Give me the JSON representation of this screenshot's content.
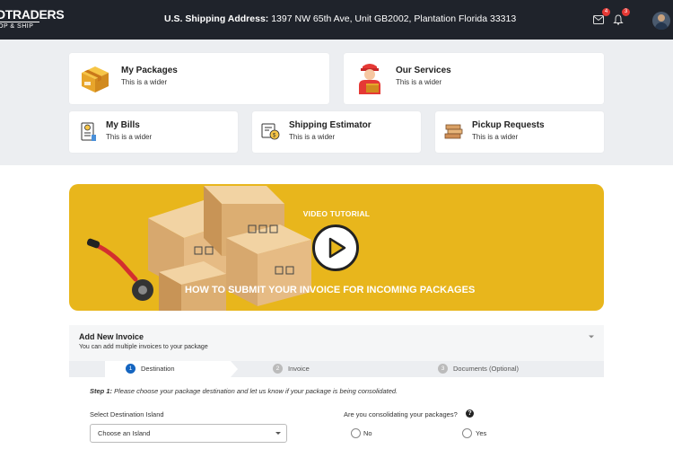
{
  "header": {
    "logo_main": "DTRADERS",
    "logo_sub": "OP & SHIP",
    "address_label": "U.S. Shipping Address:",
    "address_value": " 1397 NW 65th Ave, Unit GB2002, Plantation Florida 33313",
    "mail_badge": "4",
    "bell_badge": "3",
    "icons": [
      "mail-icon",
      "bell-icon"
    ]
  },
  "cards": [
    {
      "title": "My Packages",
      "subtitle": "This is a wider",
      "icon": "package-icon"
    },
    {
      "title": "Our Services",
      "subtitle": "This is a wider",
      "icon": "delivery-man-icon"
    },
    {
      "title": "My Bills",
      "subtitle": "This is a wider",
      "icon": "bill-icon"
    },
    {
      "title": "Shipping Estimator",
      "subtitle": "This is a wider",
      "icon": "estimator-icon"
    },
    {
      "title": "Pickup Requests",
      "subtitle": "This is a wider",
      "icon": "pickup-icon"
    }
  ],
  "banner": {
    "label": "VIDEO TUTORIAL",
    "title": "HOW TO SUBMIT YOUR INVOICE FOR INCOMING PACKAGES",
    "color": "#e8b61c"
  },
  "invoice": {
    "title": "Add New Invoice",
    "subtitle": "You can add multiple invoices to your package",
    "steps": [
      {
        "num": "1",
        "label": "Destination"
      },
      {
        "num": "2",
        "label": "Invoice"
      },
      {
        "num": "3",
        "label": "Documents (Optional)"
      }
    ],
    "step1_prefix": "Step 1:",
    "step1_text": " Please choose your package destination and let us know if your package is being consolidated.",
    "island_label": "Select Destination Island",
    "island_placeholder": "Choose an Island",
    "consolidate_label": "Are you consolidating your packages?",
    "option_no": "No",
    "option_yes": "Yes"
  }
}
